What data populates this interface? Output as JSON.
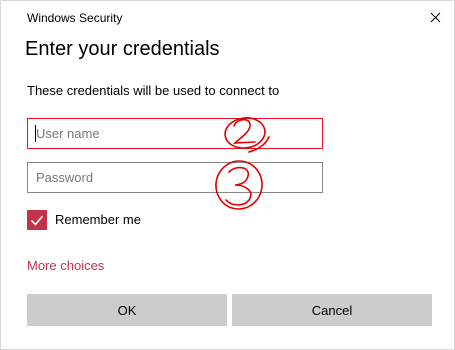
{
  "window": {
    "title": "Windows Security",
    "close_icon": "close-icon"
  },
  "dialog": {
    "heading": "Enter your credentials",
    "description": "These credentials will be used to connect to"
  },
  "form": {
    "username": {
      "value": "",
      "placeholder": "User name",
      "state": "focused"
    },
    "password": {
      "value": "",
      "placeholder": "Password"
    },
    "remember": {
      "label": "Remember me",
      "checked": true,
      "icon": "checkmark-icon"
    },
    "more_choices": "More choices"
  },
  "buttons": {
    "ok": "OK",
    "cancel": "Cancel"
  },
  "annotations": {
    "username_mark": "2",
    "password_mark": "3",
    "color": "#e00000"
  },
  "colors": {
    "accent": "#c4314b",
    "focus_border": "#e81123",
    "button_bg": "#cccccc"
  }
}
